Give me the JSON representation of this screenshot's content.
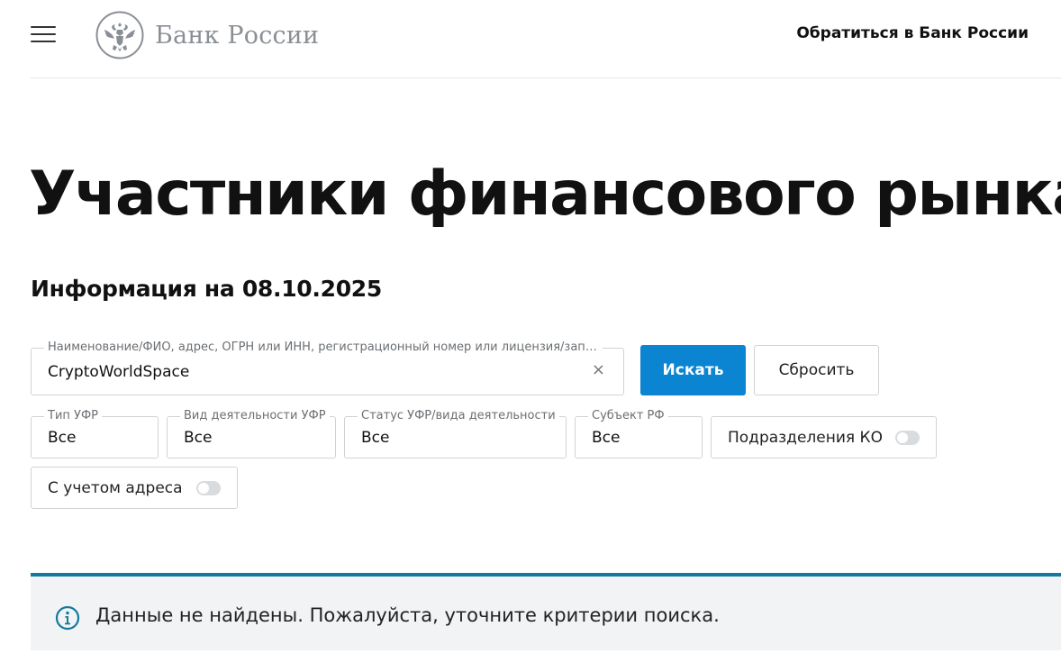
{
  "header": {
    "logo_text": "Банк России",
    "contact_link": "Обратиться в Банк России"
  },
  "main": {
    "title": "Участники финансового рынка",
    "info_date": "Информация на 08.10.2025"
  },
  "search": {
    "label": "Наименование/ФИО, адрес, ОГРН или ИНН, регистрационный номер или лицензия/запи...",
    "value": "CryptoWorldSpace",
    "clear_symbol": "×",
    "search_button": "Искать",
    "reset_button": "Сбросить"
  },
  "filters": {
    "type": {
      "label": "Тип УФР",
      "value": "Все"
    },
    "activity": {
      "label": "Вид деятельности УФР",
      "value": "Все"
    },
    "status": {
      "label": "Статус УФР/вида деятельности",
      "value": "Все"
    },
    "subject": {
      "label": "Субъект РФ",
      "value": "Все"
    },
    "branches_toggle": {
      "label": "Подразделения КО",
      "on": false
    },
    "address_toggle": {
      "label": "С учетом адреса",
      "on": false
    }
  },
  "notice": {
    "text": "Данные не найдены. Пожалуйста, уточните критерии поиска.",
    "icon": "info-icon"
  },
  "colors": {
    "accent": "#0b84d1",
    "notice_border": "#117a9e",
    "notice_bg": "#f1f3f4"
  }
}
